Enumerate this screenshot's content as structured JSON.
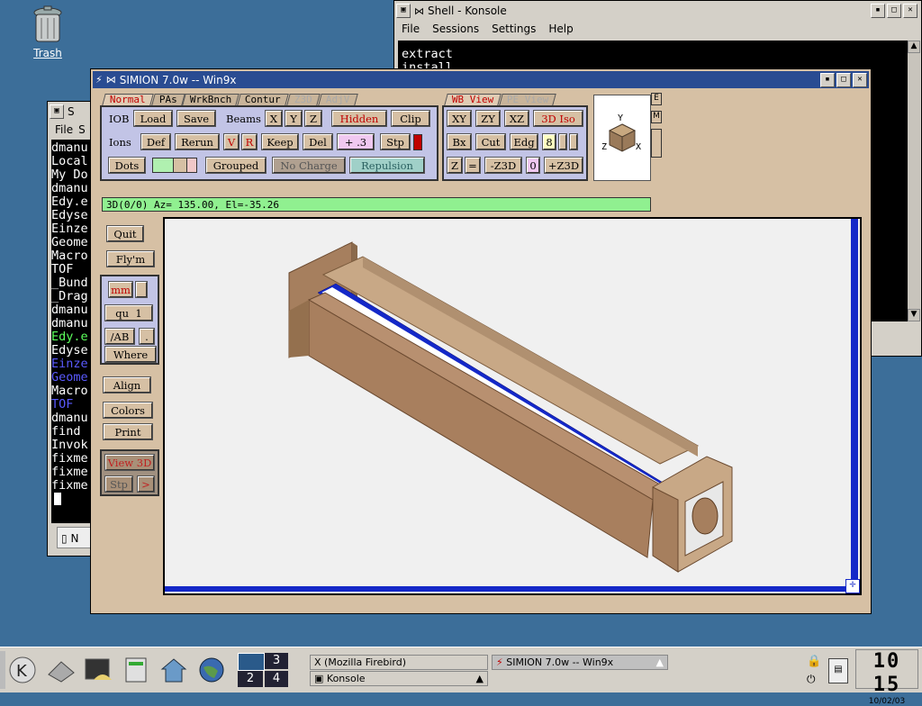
{
  "desktop": {
    "trash_label": "Trash"
  },
  "konsole_back": {
    "title_fragment": "S",
    "menu": [
      "File",
      "S"
    ],
    "lines": [
      {
        "text": "dmanu",
        "color": "#ffffff"
      },
      {
        "text": "Local",
        "color": "#ffffff"
      },
      {
        "text": "My Do",
        "color": "#ffffff"
      },
      {
        "text": "dmanu",
        "color": "#ffffff"
      },
      {
        "text": "Edy.e",
        "color": "#ffffff"
      },
      {
        "text": "Edyse",
        "color": "#ffffff"
      },
      {
        "text": "Einze",
        "color": "#ffffff"
      },
      {
        "text": "Geome",
        "color": "#ffffff"
      },
      {
        "text": "Macro",
        "color": "#ffffff"
      },
      {
        "text": "TOF",
        "color": "#ffffff"
      },
      {
        "text": "_Bund",
        "color": "#ffffff"
      },
      {
        "text": "_Drag",
        "color": "#ffffff"
      },
      {
        "text": "dmanu",
        "color": "#ffffff"
      },
      {
        "text": "dmanu",
        "color": "#ffffff"
      },
      {
        "text": "Edy.e",
        "color": "#5cff5c"
      },
      {
        "text": "Edyse",
        "color": "#ffffff"
      },
      {
        "text": "Einze",
        "color": "#5a5aff"
      },
      {
        "text": "Geome",
        "color": "#5a5aff"
      },
      {
        "text": "Macro",
        "color": "#ffffff"
      },
      {
        "text": "TOF",
        "color": "#5a5aff"
      },
      {
        "text": "dmanu",
        "color": "#ffffff"
      },
      {
        "text": "find",
        "color": "#ffffff"
      },
      {
        "text": "Invok",
        "color": "#ffffff"
      },
      {
        "text": "fixme",
        "color": "#ffffff"
      },
      {
        "text": "fixme",
        "color": "#ffffff"
      },
      {
        "text": "fixme",
        "color": "#ffffff"
      }
    ],
    "bottom_tab": "N"
  },
  "konsole": {
    "title": "Shell - Konsole",
    "menu": [
      "File",
      "Sessions",
      "Settings",
      "Help"
    ],
    "lines": [
      "extract",
      "install"
    ]
  },
  "simion": {
    "title": "SIMION 7.0w -- Win9x",
    "tabs_left": [
      "Normal",
      "PAs",
      "WrkBnch",
      "Contur",
      "Z3D",
      "AdjV"
    ],
    "tabs_right": [
      "WB View",
      "PE View"
    ],
    "iob": {
      "label": "IOB",
      "load": "Load",
      "save": "Save"
    },
    "beams": {
      "label": "Beams",
      "x": "X",
      "y": "Y",
      "z": "Z",
      "hidden": "Hidden",
      "clip": "Clip"
    },
    "ions": {
      "label": "Ions",
      "def": "Def",
      "rerun": "Rerun",
      "v": "V",
      "r": "R",
      "keep": "Keep",
      "del": "Del",
      "step": "+ .3",
      "stp": "Stp"
    },
    "dots": {
      "label": "Dots",
      "grouped": "Grouped",
      "no_charge": "No Charge",
      "repulsion": "Repulsion"
    },
    "view": {
      "xy": "XY",
      "zy": "ZY",
      "xz": "XZ",
      "iso": "3D Iso",
      "bx": "Bx",
      "cut": "Cut",
      "edg": "Edg",
      "edg_val": "8",
      "z": "Z",
      "eq": "=",
      "minus_z3d": "-Z3D",
      "z3d_val": "0",
      "plus_z3d": "+Z3D"
    },
    "axes": {
      "y": "Y",
      "z": "Z",
      "x": "X"
    },
    "side_letters": [
      "E",
      "M"
    ],
    "status": "3D(0/0) Az= 135.00, El=-35.26",
    "side": {
      "quit": "Quit",
      "flym": "Fly'm",
      "mm": "mm",
      "qu": "qu",
      "qu_val": "1",
      "ab": "/AB",
      "dot": ".",
      "where": "Where",
      "align": "Align",
      "colors": "Colors",
      "print": "Print",
      "view3d": "View 3D",
      "stp": "Stp",
      "arrow": ">"
    }
  },
  "taskbar": {
    "pager": [
      "1",
      "3",
      "2",
      "4"
    ],
    "tasks": [
      {
        "label": "(Mozilla Firebird)",
        "icon": "x-icon"
      },
      {
        "label": "Konsole",
        "icon": "konsole-icon"
      },
      {
        "label": "SIMION 7.0w -- Win9x",
        "icon": "simion-icon"
      }
    ],
    "clock": {
      "time": "10 15",
      "date": "10/02/03"
    }
  }
}
